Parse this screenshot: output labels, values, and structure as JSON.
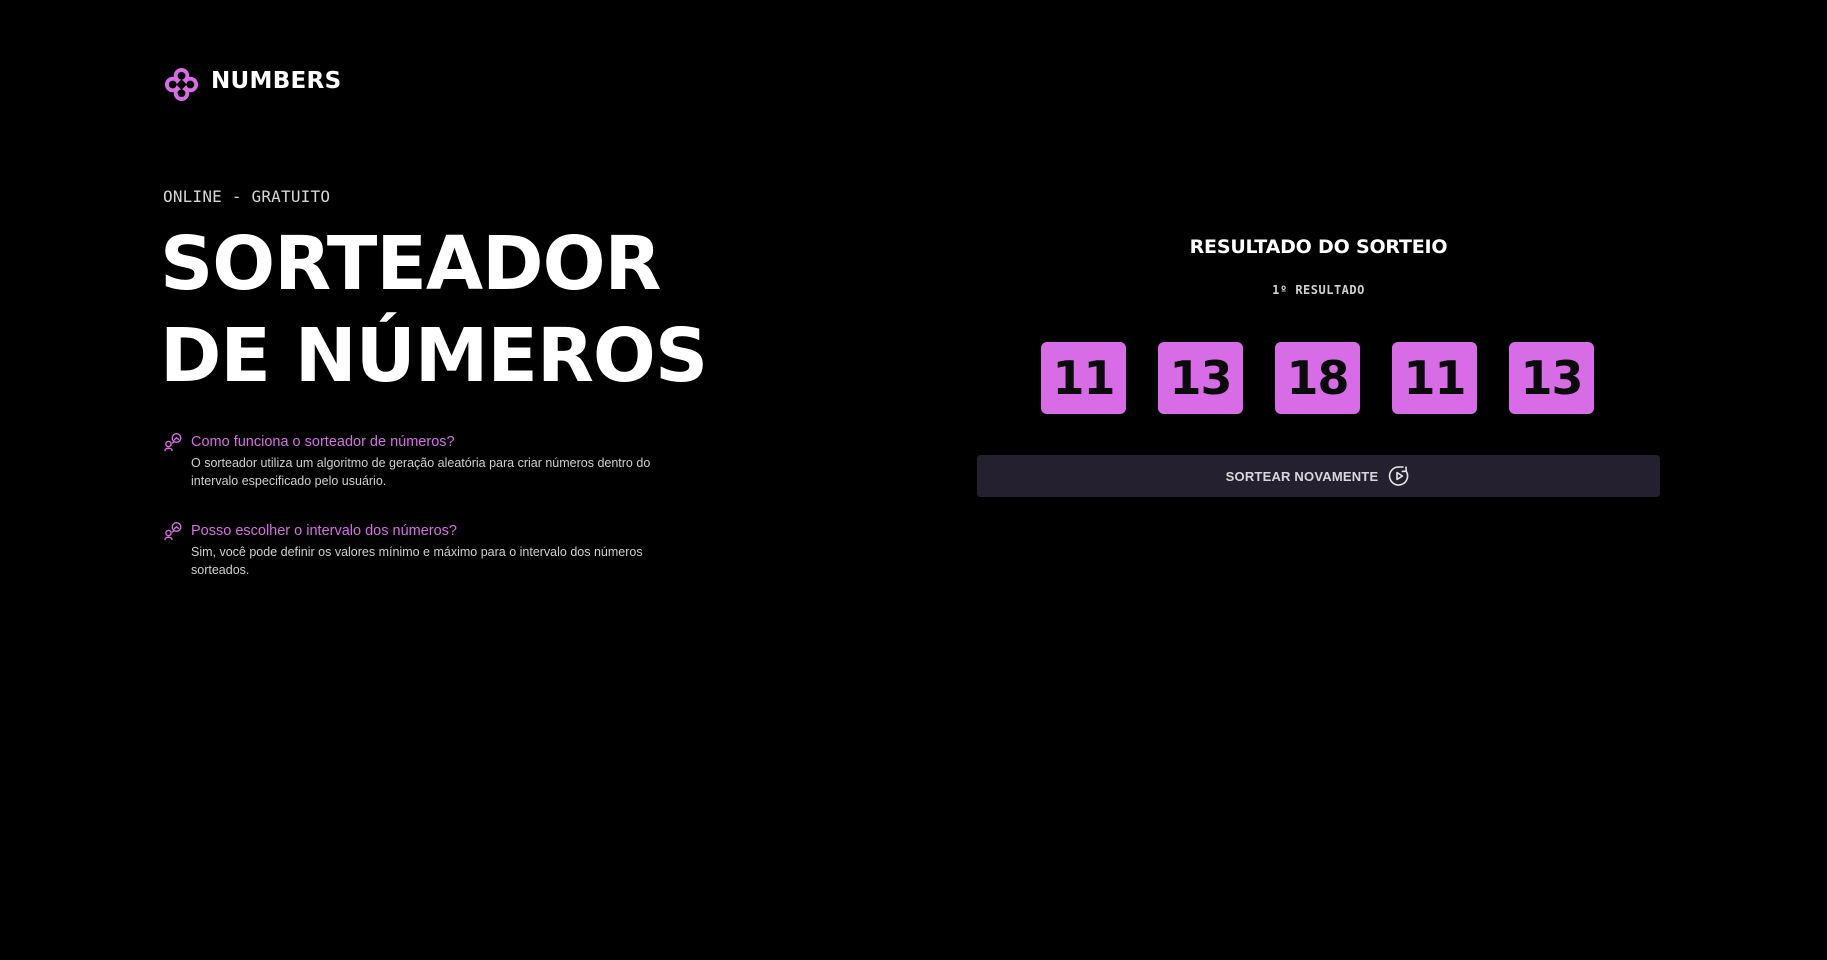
{
  "header": {
    "logo_icon": "clover-knot-icon",
    "logo_text": "NUMBERS",
    "brand_color": "#d86ce6"
  },
  "hero": {
    "eyebrow": "ONLINE - GRATUITO",
    "title_line1": "SORTEADOR",
    "title_line2": "DE NÚMEROS"
  },
  "faq": [
    {
      "icon": "chat-bubbles-icon",
      "question": "Como funciona o sorteador de números?",
      "answer": "O sorteador utiliza um algoritmo de geração aleatória para criar números dentro do intervalo especificado pelo usuário."
    },
    {
      "icon": "chat-bubbles-icon",
      "question": "Posso escolher o intervalo dos números?",
      "answer": "Sim, você pode definir os valores mínimo e máximo para o intervalo dos números sorteados."
    }
  ],
  "result": {
    "title": "RESULTADO DO SORTEIO",
    "subtitle": "1º RESULTADO",
    "numbers": [
      "11",
      "13",
      "18",
      "11",
      "13"
    ],
    "number_box_color": "#d86ce6"
  },
  "actions": {
    "redraw_label": "SORTEAR NOVAMENTE",
    "redraw_icon": "replay-icon",
    "button_bg": "#25202f"
  }
}
